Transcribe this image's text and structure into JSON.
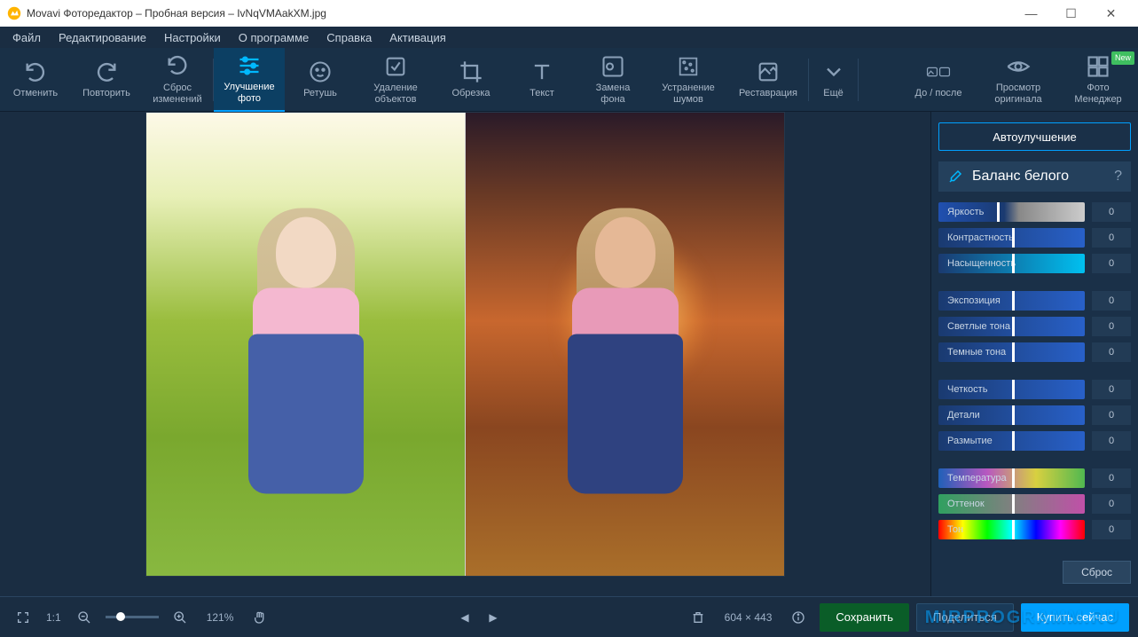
{
  "window": {
    "title": "Movavi Фоторедактор – Пробная версия – IvNqVMAakXM.jpg"
  },
  "menu": {
    "items": [
      "Файл",
      "Редактирование",
      "Настройки",
      "О программе",
      "Справка",
      "Активация"
    ]
  },
  "toolbar": {
    "undo": "Отменить",
    "redo": "Повторить",
    "reset": "Сброс\nизменений",
    "enhance": "Улучшение\nфото",
    "retouch": "Ретушь",
    "remove": "Удаление\nобъектов",
    "crop": "Обрезка",
    "text": "Текст",
    "bg": "Замена\nфона",
    "noise": "Устранение\nшумов",
    "restore": "Реставрация",
    "more": "Ещё",
    "beforeafter": "До / после",
    "preview": "Просмотр\nоригинала",
    "manager": "Фото\nМенеджер",
    "new_badge": "New"
  },
  "panel": {
    "auto": "Автоулучшение",
    "wb": "Баланс белого",
    "sliders": [
      [
        {
          "label": "Яркость",
          "val": "0",
          "cls": "grad1"
        },
        {
          "label": "Контрастность",
          "val": "0",
          "cls": "grad2"
        },
        {
          "label": "Насыщенность",
          "val": "0",
          "cls": "grad3"
        }
      ],
      [
        {
          "label": "Экспозиция",
          "val": "0",
          "cls": "grad2"
        },
        {
          "label": "Светлые тона",
          "val": "0",
          "cls": "grad2"
        },
        {
          "label": "Темные тона",
          "val": "0",
          "cls": "grad2"
        }
      ],
      [
        {
          "label": "Четкость",
          "val": "0",
          "cls": "grad2"
        },
        {
          "label": "Детали",
          "val": "0",
          "cls": "grad2"
        },
        {
          "label": "Размытие",
          "val": "0",
          "cls": "grad2"
        }
      ],
      [
        {
          "label": "Температура",
          "val": "0",
          "cls": "rainbow"
        },
        {
          "label": "Оттенок",
          "val": "0",
          "cls": "mg"
        },
        {
          "label": "Тон",
          "val": "0",
          "cls": "hue"
        }
      ]
    ],
    "reset": "Сброс"
  },
  "status": {
    "ratio": "1:1",
    "zoom": "121%",
    "dims": "604 × 443",
    "save": "Сохранить",
    "share": "Поделиться",
    "buy": "Купить сейчас"
  },
  "watermark": "MIRPROGRAMM.RU"
}
